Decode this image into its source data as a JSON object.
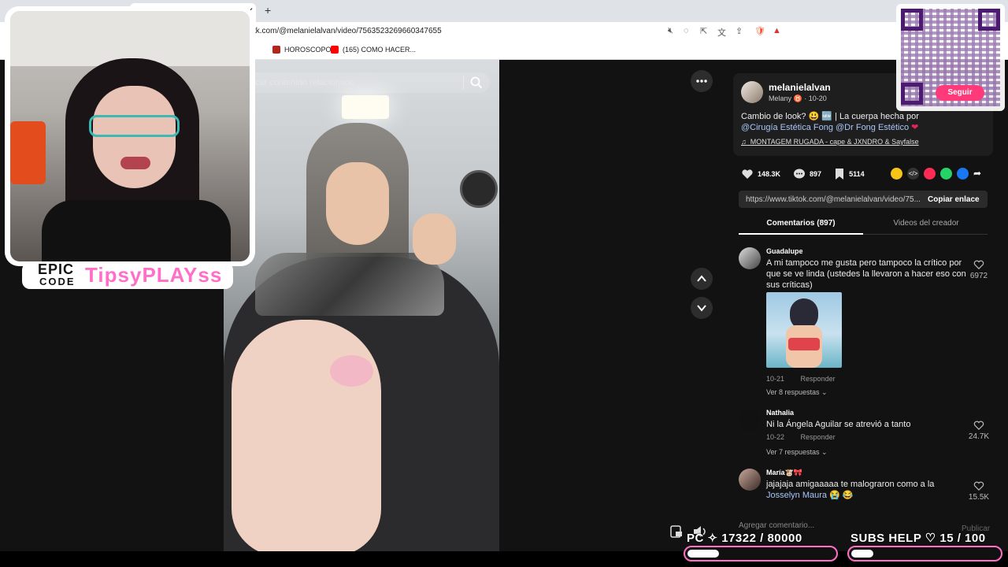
{
  "browser": {
    "url": "tk.com/@melanielalvan/video/7563523269660347655",
    "bookmarks": [
      {
        "label": "HOROSCOPO",
        "icon": "horoscope-icon",
        "color": "#b3261e"
      },
      {
        "label": "(165) COMO HACER...",
        "icon": "youtube-icon",
        "color": "#ff0000"
      }
    ]
  },
  "search": {
    "placeholder": "car contenido relacionado"
  },
  "post": {
    "username": "melanielalvan",
    "nickname": "Melany ♉ · 10-20",
    "description_pre": "Cambio de look? 😃 🆕 | La cuerpa hecha por",
    "mention_1": "@Cirugía  Estética  Fong",
    "mention_2": "@Dr Fong Estético",
    "heart_emoji": "❤",
    "music": "MONTAGEM RUGADA - cape & JXNDRO & Sayfalse",
    "likes": "148.3K",
    "comments": "897",
    "saves": "5114",
    "share_url": "https://www.tiktok.com/@melanielalvan/video/75...",
    "copy_label": "Copiar enlace"
  },
  "tabs": {
    "comments": "Comentarios (897)",
    "videos": "Videos del creador"
  },
  "comments": [
    {
      "user": "Guadalupe",
      "text": "A mi tampoco me gusta pero tampoco la crítico por que se ve linda (ustedes la llevaron a hacer eso con sus críticas)",
      "date": "10-21",
      "reply": "Responder",
      "replies": "Ver 8 respuestas ⌄",
      "likes": "6972"
    },
    {
      "user": "Nathalia",
      "text": "Ni la Ángela Aguilar se atrevió a tanto",
      "date": "10-22",
      "reply": "Responder",
      "replies": "Ver 7 respuestas ⌄",
      "likes": "24.7K"
    },
    {
      "user": "María🐮🎀",
      "text_pre": "jajajaja amigaaaaa te malograron como a la",
      "mention": "Josselyn Maura",
      "text_post": "😭 😂",
      "likes": "15.5K"
    }
  ],
  "comment_input": {
    "placeholder": "Agregar comentario..."
  },
  "publish_label": "Publicar",
  "overlay": {
    "logo_epic": "EPIC",
    "logo_code": "CODE",
    "logo_name": "TipsyPLAYss",
    "qr_follow": "Seguir",
    "counter_pc_label": "PC ✧  17322  / 80000",
    "counter_pc_value": 17322,
    "counter_pc_max": 80000,
    "counter_subs_label": "SUBS HELP ♡   15  / 100",
    "counter_subs_value": 15,
    "counter_subs_max": 100,
    "accent_color": "#ff6fc7"
  }
}
